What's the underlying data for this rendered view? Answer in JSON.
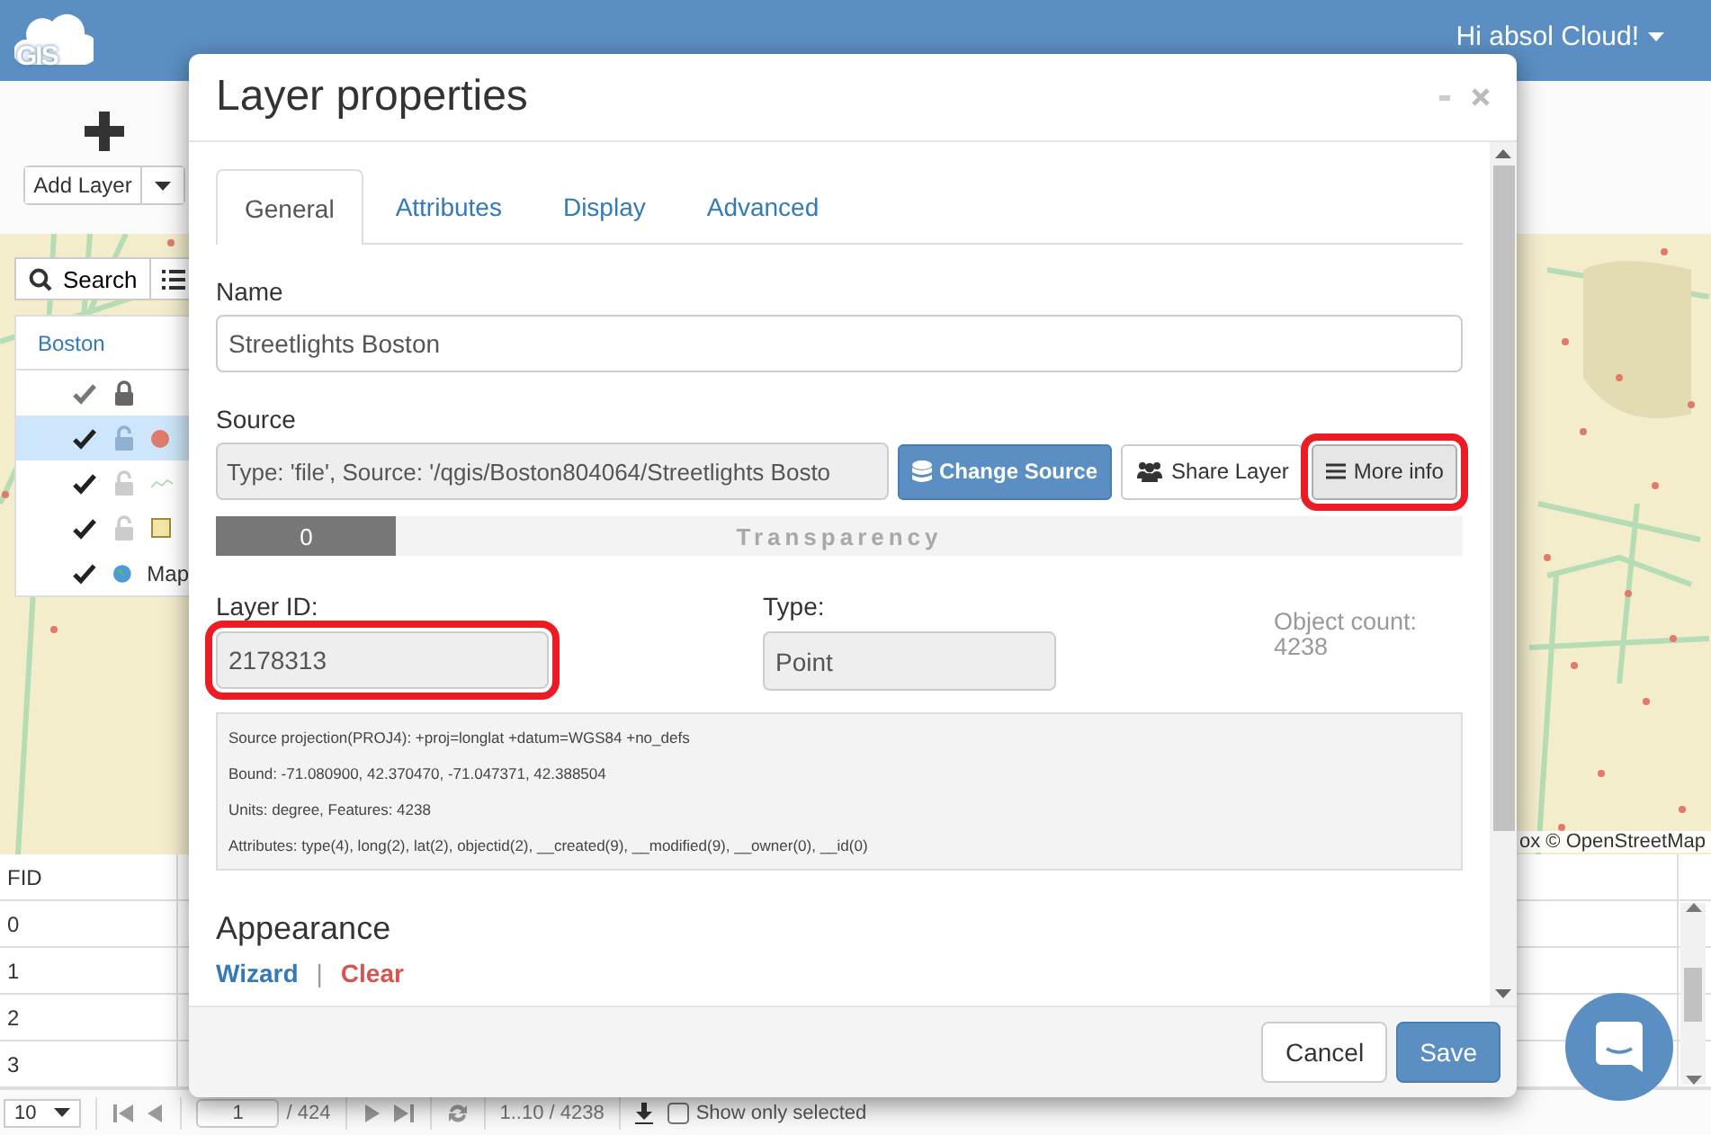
{
  "header": {
    "logo": "GIS",
    "user_menu": "Hi absol Cloud!"
  },
  "toolbar": {
    "add_layer": "Add Layer"
  },
  "layer_panel": {
    "search": "Search",
    "group": "Boston",
    "rows": [
      {
        "kind": "header",
        "visible": true,
        "locked": true,
        "selected": false
      },
      {
        "kind": "point",
        "visible": true,
        "locked": false,
        "selected": true
      },
      {
        "kind": "line",
        "visible": true,
        "locked": false,
        "selected": false
      },
      {
        "kind": "polygon",
        "visible": true,
        "locked": false,
        "selected": false
      },
      {
        "kind": "basemap",
        "visible": true,
        "label": "Map",
        "selected": false
      }
    ]
  },
  "map": {
    "attribution": "ox © OpenStreetMap"
  },
  "table": {
    "columns": [
      "FID"
    ],
    "rows": [
      "0",
      "1",
      "2",
      "3"
    ]
  },
  "pager": {
    "page_size": "10",
    "page": "1",
    "pages": "/ 424",
    "range": "1..10 / 4238",
    "show_selected": {
      "label": "Show only selected",
      "checked": false
    }
  },
  "dialog": {
    "title": "Layer properties",
    "tabs": [
      {
        "label": "General",
        "selected": true
      },
      {
        "label": "Attributes",
        "selected": false
      },
      {
        "label": "Display",
        "selected": false
      },
      {
        "label": "Advanced",
        "selected": false
      }
    ],
    "name": {
      "label": "Name",
      "value": "Streetlights Boston"
    },
    "source": {
      "label": "Source",
      "value": "Type: 'file', Source: '/qgis/Boston804064/Streetlights Bosto"
    },
    "actions": [
      {
        "kind": "primary",
        "label": "Change Source",
        "highlighted": false
      },
      {
        "kind": "default",
        "label": "Share Layer",
        "highlighted": false
      },
      {
        "kind": "active",
        "label": "More info",
        "highlighted": true
      }
    ],
    "transparency": {
      "value": "0",
      "label": "Transparency",
      "level": 0.145
    },
    "layer_id": {
      "label": "Layer ID:",
      "value": "2178313",
      "highlighted": true
    },
    "type": {
      "label": "Type:",
      "value": "Point"
    },
    "object_count": {
      "label": "Object count:",
      "value": "4238"
    },
    "info_lines": [
      "Source projection(PROJ4): +proj=longlat +datum=WGS84 +no_defs",
      "Bound: -71.080900, 42.370470, -71.047371, 42.388504",
      "Units: degree, Features: 4238",
      "Attributes: type(4), long(2), lat(2), objectid(2), __created(9), __modified(9), __owner(0), __id(0)"
    ],
    "appearance": {
      "heading": "Appearance",
      "links": [
        {
          "kind": "primary",
          "label": "Wizard"
        },
        {
          "kind": "danger",
          "label": "Clear"
        }
      ],
      "separator": "|"
    },
    "footer_buttons": [
      {
        "kind": "default",
        "label": "Cancel"
      },
      {
        "kind": "primary",
        "label": "Save"
      }
    ]
  }
}
